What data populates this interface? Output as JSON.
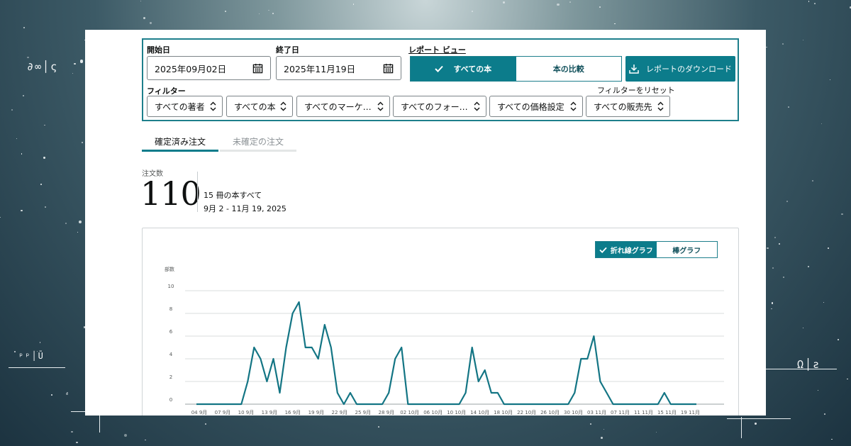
{
  "filters_panel": {
    "start_label": "開始日",
    "start_value": "2025年09月02日",
    "end_label": "終了日",
    "end_value": "2025年11月19日",
    "view_label": "レポート ビュー",
    "view_all_books": "すべての本",
    "view_compare": "本の比較",
    "download_label": "レポートのダウンロード",
    "filter_label": "フィルター",
    "reset_label": "フィルターをリセット",
    "filters": [
      "すべての著者",
      "すべての本",
      "すべてのマーケ…",
      "すべてのフォー…",
      "すべての価格設定",
      "すべての販売先"
    ]
  },
  "tabs": {
    "confirmed": "確定済み注文",
    "unconfirmed": "未確定の注文"
  },
  "kpi": {
    "label": "注文数",
    "value": "110",
    "books": "15 冊の本すべて",
    "range": "9月 2 - 11月 19, 2025"
  },
  "chart_toggle": {
    "line": "折れ線グラフ",
    "bar": "棒グラフ"
  },
  "colors": {
    "accent": "#0c7c8b",
    "line": "#137584"
  },
  "chart_data": {
    "type": "line",
    "ylabel": "部数",
    "ylim": [
      0,
      10
    ],
    "yticks": [
      0,
      2,
      4,
      6,
      8,
      10
    ],
    "x_tick_labels": [
      "04 9月",
      "07 9月",
      "10 9月",
      "13 9月",
      "16 9月",
      "19 9月",
      "22 9月",
      "25 9月",
      "28 9月",
      "02 10月",
      "06 10月",
      "10 10月",
      "14 10月",
      "18 10月",
      "22 10月",
      "26 10月",
      "30 10月",
      "03 11月",
      "07 11月",
      "11 11月",
      "15 11月",
      "19 11月"
    ],
    "series": [
      {
        "values": [
          0,
          0,
          0,
          0,
          0,
          0,
          0,
          0,
          2,
          5,
          4,
          2,
          4,
          1,
          5,
          8,
          9,
          5,
          5,
          4,
          7,
          5,
          1,
          0,
          1,
          0,
          0,
          0,
          0,
          0,
          1,
          4,
          5,
          0,
          0,
          0,
          0,
          0,
          0,
          0,
          0,
          0,
          1,
          5,
          2,
          3,
          1,
          1,
          0,
          0,
          0,
          0,
          0,
          0,
          0,
          0,
          0,
          0,
          0,
          1,
          4,
          4,
          6,
          2,
          1,
          0,
          0,
          0,
          0,
          0,
          0,
          0,
          0,
          1,
          0,
          0,
          0,
          0,
          0
        ]
      }
    ]
  }
}
